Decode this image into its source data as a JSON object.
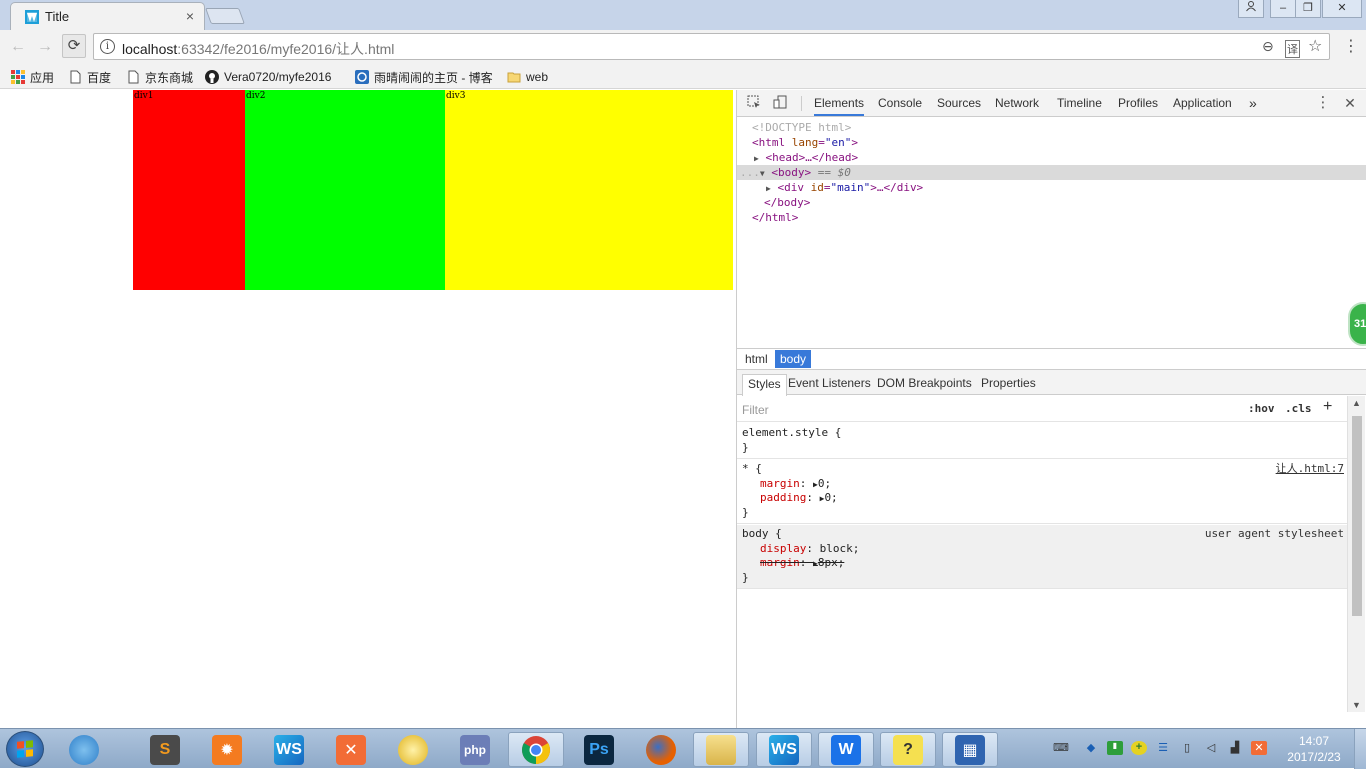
{
  "tab": {
    "title": "Title",
    "close": "×"
  },
  "window_controls": {
    "user": "👤",
    "minimize": "–",
    "restore": "❐",
    "close": "✕"
  },
  "toolbar": {
    "back": "←",
    "forward": "→",
    "reload": "⟳",
    "info": "i",
    "url_host": "localhost",
    "url_path": ":63342/fe2016/myfe2016/让人.html",
    "zoom_icon": "⊖",
    "translate_icon": "译",
    "star_icon": "☆",
    "menu": "⋮"
  },
  "bookmarks": [
    {
      "label": "应用",
      "icon": "apps-icon"
    },
    {
      "label": "百度",
      "icon": "page-icon"
    },
    {
      "label": "京东商城",
      "icon": "page-icon"
    },
    {
      "label": "Vera0720/myfe2016",
      "icon": "github-icon"
    },
    {
      "label": "雨晴闹闹的主页 - 博客",
      "icon": "blog-icon"
    },
    {
      "label": "web",
      "icon": "folder-icon"
    }
  ],
  "page": {
    "divs": [
      {
        "label": "div1",
        "color": "#ff0000"
      },
      {
        "label": "div2",
        "color": "#00ff00"
      },
      {
        "label": "div3",
        "color": "#ffff00"
      }
    ]
  },
  "devtools": {
    "tabs": [
      "Elements",
      "Console",
      "Sources",
      "Network",
      "Timeline",
      "Profiles",
      "Application"
    ],
    "more": "»",
    "menu": "⋮",
    "close": "✕",
    "dom": {
      "doctype": "<!DOCTYPE html>",
      "html_open_tag": "<html",
      "html_attr": "lang",
      "html_attr_val": "\"en\"",
      "html_open_end": ">",
      "head": "<head>…</head>",
      "body_open": "<body>",
      "body_eq": " == $0",
      "div_open": "<div",
      "div_attr": "id",
      "div_attr_val": "\"main\"",
      "div_rest": ">…</div>",
      "body_close": "</body>",
      "html_close": "</html>",
      "ellipsis": "...",
      "eq_sign": "="
    },
    "breadcrumbs": [
      "html",
      "body"
    ],
    "sub_tabs": [
      "Styles",
      "Event Listeners",
      "DOM Breakpoints",
      "Properties"
    ],
    "filter": {
      "placeholder": "Filter",
      "hov": ":hov",
      "cls": ".cls",
      "add": "+"
    },
    "rules": {
      "element_style": {
        "selector": "element.style {",
        "close": "}"
      },
      "star": {
        "selector": "* {",
        "source": "让人.html:7",
        "decls": [
          {
            "prop": "margin",
            "value": "0;"
          },
          {
            "prop": "padding",
            "value": "0;"
          }
        ],
        "close": "}"
      },
      "body": {
        "selector": "body {",
        "source": "user agent stylesheet",
        "decls": [
          {
            "prop": "display",
            "value": "block;"
          },
          {
            "prop": "margin",
            "value": "8px;"
          }
        ],
        "close": "}"
      }
    },
    "side_badge": "31"
  },
  "taskbar": {
    "apps": [
      "360",
      "Sublime Text",
      "Settings",
      "WebStorm",
      "XAMPP",
      "Thunder",
      "PHP",
      "Chrome",
      "Photoshop",
      "Firefox",
      "Explorer",
      "WebStorm",
      "WPS",
      "Help",
      "Diskpart"
    ],
    "clock_time": "14:07",
    "clock_date": "2017/2/23"
  },
  "colors": {
    "accent": "#3879d9",
    "red_div": "#ff0000",
    "green_div": "#00ff00",
    "yellow_div": "#ffff00"
  }
}
